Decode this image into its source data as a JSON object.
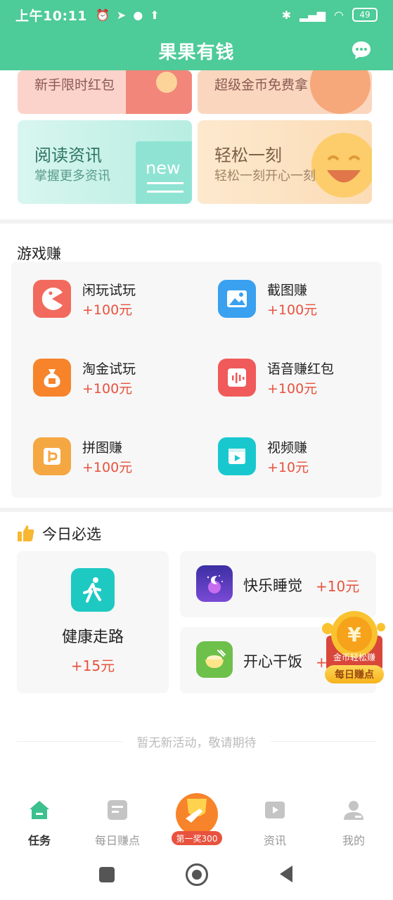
{
  "status_bar": {
    "time": "上午10:11",
    "battery": "49"
  },
  "header": {
    "title": "果果有钱"
  },
  "banners": {
    "newbie": {
      "title": "新手限时红包"
    },
    "gold": {
      "title": "超级金币免费拿"
    },
    "read": {
      "title": "阅读资讯",
      "subtitle": "掌握更多资讯",
      "decor": "new"
    },
    "relax": {
      "title": "轻松一刻",
      "subtitle": "轻松一刻开心一刻"
    }
  },
  "game_section": {
    "title": "游戏赚",
    "items": [
      {
        "name": "闲玩试玩",
        "reward": "+100元",
        "icon": "pacman-icon",
        "color": "#f26a5d"
      },
      {
        "name": "截图赚",
        "reward": "+100元",
        "icon": "image-icon",
        "color": "#3aa0f0"
      },
      {
        "name": "淘金试玩",
        "reward": "+100元",
        "icon": "money-bag-icon",
        "color": "#f7842a"
      },
      {
        "name": "语音赚红包",
        "reward": "+100元",
        "icon": "voice-icon",
        "color": "#f05a5a"
      },
      {
        "name": "拼图赚",
        "reward": "+100元",
        "icon": "puzzle-icon",
        "color": "#f5a742"
      },
      {
        "name": "视频赚",
        "reward": "+10元",
        "icon": "video-icon",
        "color": "#19c8cf"
      }
    ]
  },
  "daily_section": {
    "title": "今日必选",
    "walk": {
      "name": "健康走路",
      "reward": "+15元"
    },
    "sleep": {
      "name": "快乐睡觉",
      "reward": "+10元"
    },
    "meal": {
      "name": "开心干饭",
      "reward": "+10元"
    },
    "floating_badge": {
      "line1": "金币轻松赚",
      "line2": "每日赚点"
    }
  },
  "empty_note": "暂无新活动，敬请期待",
  "bottom_nav": {
    "items": [
      {
        "label": "任务"
      },
      {
        "label": "每日赚点"
      },
      {
        "label": "第一奖300"
      },
      {
        "label": "资讯"
      },
      {
        "label": "我的"
      }
    ]
  },
  "colors": {
    "brand": "#4dcb98",
    "reward": "#e8523e"
  }
}
